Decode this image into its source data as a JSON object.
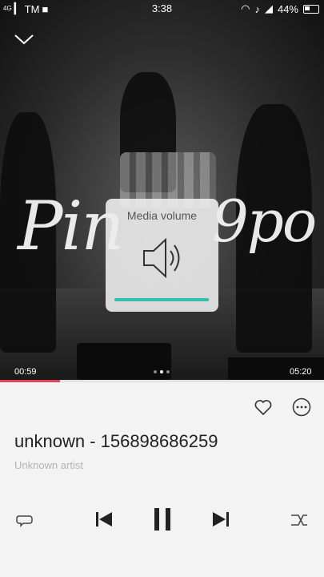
{
  "status_bar": {
    "carrier_left": "TM",
    "signal_tiny": "4G",
    "time": "3:38",
    "battery": "44%"
  },
  "artwork": {
    "scribble_left": "Pin",
    "scribble_right": "9po"
  },
  "player": {
    "elapsed": "00:59",
    "duration": "05:20",
    "progress_fraction": 0.184,
    "page_count": 3,
    "active_page": 2
  },
  "volume_popup": {
    "title": "Media volume",
    "level_fraction": 0.99,
    "accent": "#30c1a9"
  },
  "track": {
    "title": "unknown - 156898686259",
    "artist": "Unknown artist"
  },
  "colors": {
    "progress": "#e2425a",
    "controls": "#222222"
  },
  "icons": [
    "collapse-chevron-icon",
    "heart-icon",
    "more-icon",
    "repeat-icon",
    "previous-icon",
    "pause-icon",
    "next-icon",
    "shuffle-icon",
    "speaker-icon"
  ]
}
